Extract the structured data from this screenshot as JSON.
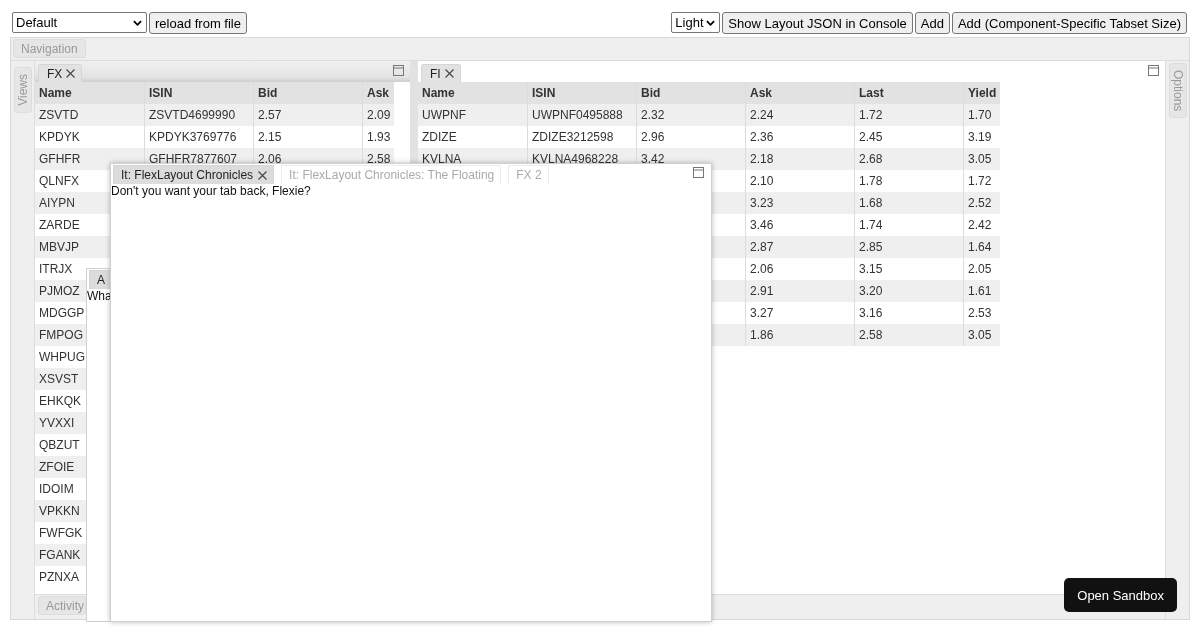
{
  "toolbar": {
    "layout_select": {
      "value": "Default"
    },
    "reload_button": "reload from file",
    "theme_select": {
      "value": "Light"
    },
    "buttons": [
      "Show Layout JSON in Console",
      "Add",
      "Add (Component-Specific Tabset Size)"
    ]
  },
  "borders": {
    "top": [
      {
        "label": "Navigation",
        "selected": false
      }
    ],
    "left": [
      {
        "label": "Views",
        "selected": false
      }
    ],
    "right": [
      {
        "label": "Options",
        "selected": false
      }
    ],
    "bottom": [
      {
        "label": "Activity",
        "selected": false
      }
    ]
  },
  "tabsets": [
    {
      "active": true,
      "tabs": [
        {
          "label": "FX",
          "selected": true,
          "closable": true
        }
      ],
      "table": {
        "columns": [
          "Name",
          "ISIN",
          "Bid",
          "Ask"
        ],
        "rows": [
          [
            "ZSVTD",
            "ZSVTD4699990",
            "2.57",
            "2.09"
          ],
          [
            "KPDYK",
            "KPDYK3769776",
            "2.15",
            "1.93"
          ],
          [
            "GFHFR",
            "GFHFR7877607",
            "2.06",
            "2.58"
          ],
          [
            "QLNFX",
            null,
            null,
            null
          ],
          [
            "AIYPN",
            null,
            null,
            null
          ],
          [
            "ZARDE",
            null,
            null,
            null
          ],
          [
            "MBVJP",
            null,
            null,
            null
          ],
          [
            "ITRJX",
            null,
            null,
            null
          ],
          [
            "PJMOZ",
            null,
            null,
            null
          ],
          [
            "MDGGP",
            null,
            null,
            null
          ],
          [
            "FMPOG",
            null,
            null,
            null
          ],
          [
            "WHPUG",
            null,
            null,
            null
          ],
          [
            "XSVST",
            null,
            null,
            null
          ],
          [
            "EHKQK",
            null,
            null,
            null
          ],
          [
            "YVXXI",
            null,
            null,
            null
          ],
          [
            "QBZUT",
            null,
            null,
            null
          ],
          [
            "ZFOIE",
            null,
            null,
            null
          ],
          [
            "IDOIM",
            null,
            null,
            null
          ],
          [
            "VPKKN",
            null,
            null,
            null
          ],
          [
            "FWFGK",
            null,
            null,
            null
          ],
          [
            "FGANK",
            null,
            null,
            null
          ],
          [
            "PZNXA",
            null,
            null,
            null
          ]
        ]
      }
    },
    {
      "active": false,
      "tabs": [
        {
          "label": "FI",
          "selected": true,
          "closable": true
        }
      ],
      "table": {
        "columns": [
          "Name",
          "ISIN",
          "Bid",
          "Ask",
          "Last",
          "Yield"
        ],
        "rows": [
          [
            "UWPNF",
            "UWPNF0495888",
            "2.32",
            "2.24",
            "1.72",
            "1.70"
          ],
          [
            "ZDIZE",
            "ZDIZE3212598",
            "2.96",
            "2.36",
            "2.45",
            "3.19"
          ],
          [
            "KVLNA",
            "KVLNA4968228",
            "3.42",
            "2.18",
            "2.68",
            "3.05"
          ],
          [
            null,
            null,
            null,
            "2.10",
            "1.78",
            "1.72"
          ],
          [
            null,
            null,
            null,
            "3.23",
            "1.68",
            "2.52"
          ],
          [
            null,
            null,
            null,
            "3.46",
            "1.74",
            "2.42"
          ],
          [
            null,
            null,
            null,
            "2.87",
            "2.85",
            "1.64"
          ],
          [
            null,
            null,
            null,
            "2.06",
            "3.15",
            "2.05"
          ],
          [
            null,
            null,
            null,
            "2.91",
            "3.20",
            "1.61"
          ],
          [
            null,
            null,
            null,
            "3.27",
            "3.16",
            "2.53"
          ],
          [
            null,
            null,
            null,
            "1.86",
            "2.58",
            "3.05"
          ]
        ]
      }
    }
  ],
  "floating_windows": [
    {
      "maximize_icon": false,
      "tabs": [
        {
          "label": "A",
          "selected": true,
          "closable": false
        }
      ],
      "content": "Wha"
    },
    {
      "maximize_icon": true,
      "tabs": [
        {
          "label": "It: FlexLayout Chronicles",
          "selected": true,
          "closable": true
        },
        {
          "label": "It: FlexLayout Chronicles: The Floating",
          "selected": false,
          "closable": false
        },
        {
          "label": "FX 2",
          "selected": false,
          "closable": false
        }
      ],
      "content": "Don't you want your tab back, Flexie?"
    }
  ],
  "sandbox_button": "Open Sandbox"
}
